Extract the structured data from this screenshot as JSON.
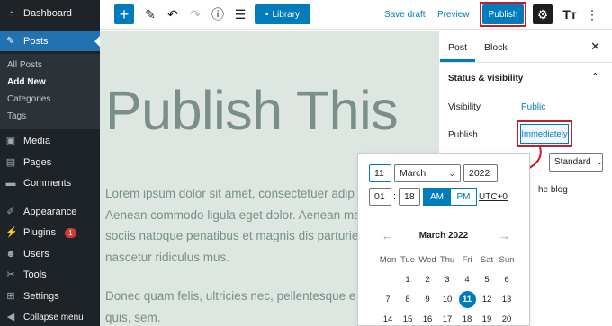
{
  "sidebar": {
    "items": [
      {
        "label": "Dashboard",
        "icon": "dashboard-icon"
      },
      {
        "label": "Posts",
        "icon": "pin-icon"
      },
      {
        "label": "Media",
        "icon": "media-icon"
      },
      {
        "label": "Pages",
        "icon": "pages-icon"
      },
      {
        "label": "Comments",
        "icon": "comments-icon"
      },
      {
        "label": "Appearance",
        "icon": "appearance-icon"
      },
      {
        "label": "Plugins",
        "icon": "plugins-icon",
        "badge": "1"
      },
      {
        "label": "Users",
        "icon": "users-icon"
      },
      {
        "label": "Tools",
        "icon": "tools-icon"
      },
      {
        "label": "Settings",
        "icon": "settings-icon"
      },
      {
        "label": "Collapse menu",
        "icon": "collapse-icon"
      }
    ],
    "submenu": [
      "All Posts",
      "Add New",
      "Categories",
      "Tags"
    ]
  },
  "toolbar": {
    "library_label": "Library",
    "save_draft_label": "Save draft",
    "preview_label": "Preview",
    "publish_label": "Publish"
  },
  "content": {
    "title": "Publish This",
    "paragraph1": [
      "Lorem ipsum dolor sit amet, consectetuer adip",
      "Aenean commodo ligula eget dolor. Aenean ma",
      "sociis natoque penatibus et magnis dis parturie",
      "nascetur ridiculus mus."
    ],
    "paragraph2": [
      "Donec quam felis, ultricies nec, pellentesque e",
      "quis, sem."
    ]
  },
  "settings_panel": {
    "tab_post": "Post",
    "tab_block": "Block",
    "section_title": "Status & visibility",
    "visibility_label": "Visibility",
    "visibility_value": "Public",
    "publish_label": "Publish",
    "publish_value": "Immediately",
    "template_value": "Standard",
    "blog_text": "he blog"
  },
  "datepicker": {
    "day": "11",
    "month": "March",
    "year": "2022",
    "hour": "01",
    "minute": "18",
    "am_label": "AM",
    "pm_label": "PM",
    "timezone": "UTC+0",
    "calendar_title": "March 2022",
    "weekdays": [
      "Mon",
      "Tue",
      "Wed",
      "Thu",
      "Fri",
      "Sat",
      "Sun"
    ],
    "weeks": [
      [
        "",
        "1",
        "2",
        "3",
        "4",
        "5",
        "6"
      ],
      [
        "7",
        "8",
        "9",
        "10",
        "11",
        "12",
        "13"
      ],
      [
        "14",
        "15",
        "16",
        "17",
        "18",
        "19",
        "20"
      ]
    ],
    "selected_day": "11"
  },
  "colors": {
    "admin_bg": "#1d2327",
    "accent": "#007cba",
    "highlight_red": "#c41d2a",
    "canvas_bg": "#dde6e1"
  }
}
